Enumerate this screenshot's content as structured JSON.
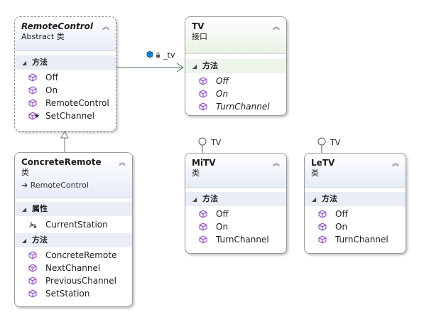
{
  "remote_control": {
    "title": "RemoteControl",
    "subtitle": "Abstract 类",
    "methods_header": "方法",
    "methods": [
      "Off",
      "On",
      "RemoteControl",
      "SetChannel"
    ]
  },
  "tv": {
    "title": "TV",
    "subtitle": "接口",
    "methods_header": "方法",
    "methods": [
      "Off",
      "On",
      "TurnChannel"
    ]
  },
  "association_label": "_tv",
  "concrete_remote": {
    "title": "ConcreteRemote",
    "subtitle": "类",
    "base": "RemoteControl",
    "properties_header": "属性",
    "properties": [
      "CurrentStation"
    ],
    "methods_header": "方法",
    "methods": [
      "ConcreteRemote",
      "NextChannel",
      "PreviousChannel",
      "SetStation"
    ]
  },
  "mitv": {
    "lollipop": "TV",
    "title": "MiTV",
    "subtitle": "类",
    "methods_header": "方法",
    "methods": [
      "Off",
      "On",
      "TurnChannel"
    ]
  },
  "letv": {
    "lollipop": "TV",
    "title": "LeTV",
    "subtitle": "类",
    "methods_header": "方法",
    "methods": [
      "Off",
      "On",
      "TurnChannel"
    ]
  },
  "colors": {
    "method_icon": "#8a4bb8",
    "association_line": "#3c7a3c",
    "inheritance_line": "#777777"
  }
}
